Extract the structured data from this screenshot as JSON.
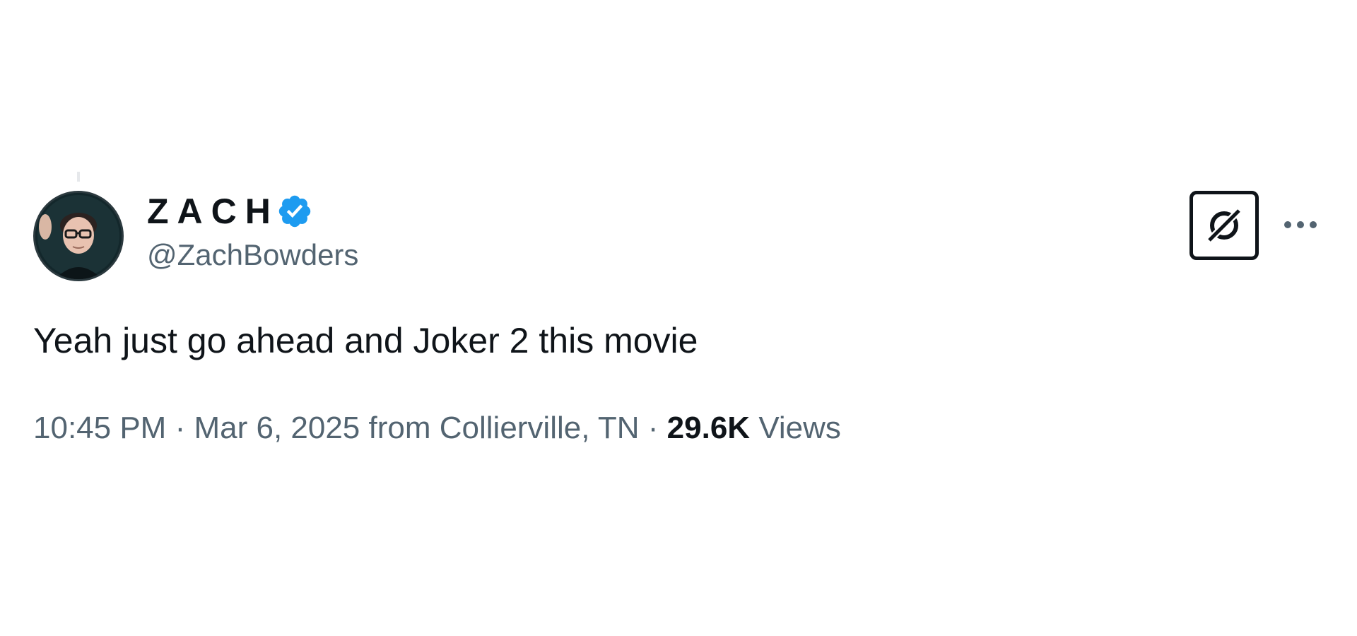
{
  "author": {
    "display_name": "ZACH",
    "handle": "@ZachBowders",
    "verified": true,
    "verified_color": "#1d9bf0",
    "avatar_icon": "profile-photo"
  },
  "tweet": {
    "text": "Yeah just go ahead and Joker 2 this movie"
  },
  "meta": {
    "time": "10:45 PM",
    "separator": "·",
    "date": "Mar 6, 2025",
    "location": "from Collierville, TN",
    "views_count": "29.6K",
    "views_label": "Views"
  },
  "actions": {
    "grok_icon": "grok-icon",
    "more_icon": "more-options-icon"
  },
  "colors": {
    "text_primary": "#0f1419",
    "text_secondary": "#536471",
    "background": "#ffffff"
  }
}
